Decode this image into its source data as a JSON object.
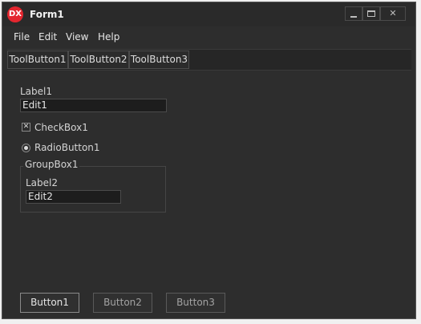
{
  "window": {
    "title": "Form1",
    "icon_text": "DX",
    "close_glyph": "✕"
  },
  "menu": {
    "items": [
      "File",
      "Edit",
      "View",
      "Help"
    ]
  },
  "toolbar": {
    "buttons": [
      "ToolButton1",
      "ToolButton2",
      "ToolButton3"
    ]
  },
  "form": {
    "label1": "Label1",
    "edit1_value": "Edit1",
    "checkbox1_label": "CheckBox1",
    "checkbox1_mark": "✕",
    "radio1_label": "RadioButton1",
    "groupbox1_caption": "GroupBox1",
    "label2": "Label2",
    "edit2_value": "Edit2"
  },
  "buttons": [
    "Button1",
    "Button2",
    "Button3"
  ],
  "colors": {
    "accent_icon": "#e3262f",
    "window_bg": "#2d2d2d"
  }
}
